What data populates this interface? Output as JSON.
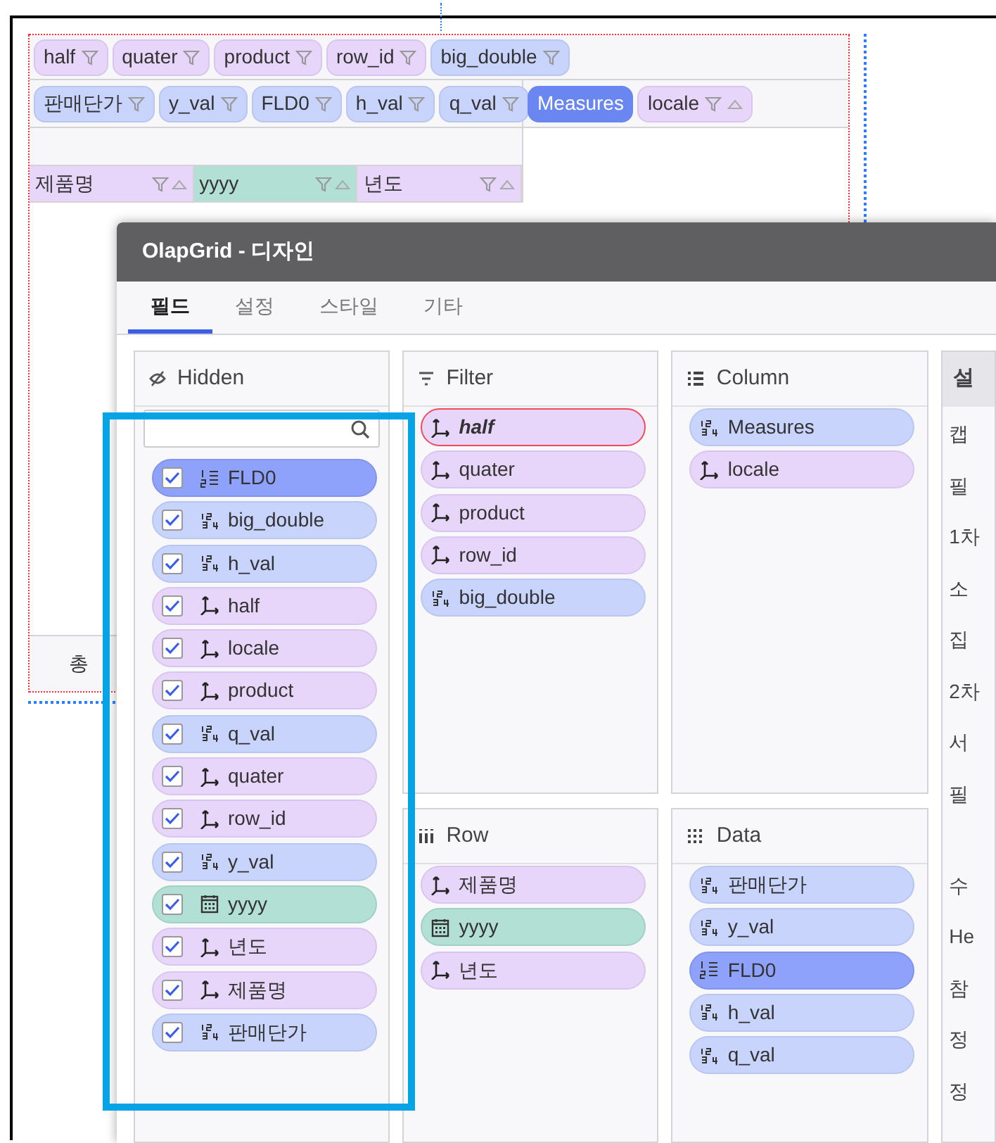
{
  "grid": {
    "filter_chips": [
      {
        "label": "half",
        "kind": "dimension"
      },
      {
        "label": "quater",
        "kind": "dimension"
      },
      {
        "label": "product",
        "kind": "dimension"
      },
      {
        "label": "row_id",
        "kind": "dimension"
      },
      {
        "label": "big_double",
        "kind": "measure"
      }
    ],
    "data_chips": [
      {
        "label": "판매단가",
        "kind": "measure"
      },
      {
        "label": "y_val",
        "kind": "measure"
      },
      {
        "label": "FLD0",
        "kind": "measure"
      },
      {
        "label": "h_val",
        "kind": "measure"
      },
      {
        "label": "q_val",
        "kind": "measure"
      }
    ],
    "column_chips": [
      {
        "label": "Measures",
        "kind": "measures"
      },
      {
        "label": "locale",
        "kind": "dimension"
      }
    ],
    "row_headers": [
      {
        "label": "제품명",
        "kind": "dimension"
      },
      {
        "label": "yyyy",
        "kind": "date"
      },
      {
        "label": "년도",
        "kind": "dimension"
      }
    ],
    "footer": "총"
  },
  "dialog": {
    "title": "OlapGrid - 디자인",
    "tabs": [
      {
        "label": "필드",
        "selected": true
      },
      {
        "label": "설정",
        "selected": false
      },
      {
        "label": "스타일",
        "selected": false
      },
      {
        "label": "기타",
        "selected": false
      }
    ],
    "hidden": {
      "title": "Hidden",
      "items": [
        {
          "label": "FLD0",
          "kind": "calc",
          "checked": true
        },
        {
          "label": "big_double",
          "kind": "measure",
          "checked": true
        },
        {
          "label": "h_val",
          "kind": "measure",
          "checked": true
        },
        {
          "label": "half",
          "kind": "dimension",
          "checked": true
        },
        {
          "label": "locale",
          "kind": "dimension",
          "checked": true
        },
        {
          "label": "product",
          "kind": "dimension",
          "checked": true
        },
        {
          "label": "q_val",
          "kind": "measure",
          "checked": true
        },
        {
          "label": "quater",
          "kind": "dimension",
          "checked": true
        },
        {
          "label": "row_id",
          "kind": "dimension",
          "checked": true
        },
        {
          "label": "y_val",
          "kind": "measure",
          "checked": true
        },
        {
          "label": "yyyy",
          "kind": "date",
          "checked": true
        },
        {
          "label": "년도",
          "kind": "dimension",
          "checked": true
        },
        {
          "label": "제품명",
          "kind": "dimension",
          "checked": true
        },
        {
          "label": "판매단가",
          "kind": "measure",
          "checked": true
        }
      ]
    },
    "filter": {
      "title": "Filter",
      "items": [
        {
          "label": "half",
          "kind": "dimension",
          "selected": true
        },
        {
          "label": "quater",
          "kind": "dimension",
          "selected": false
        },
        {
          "label": "product",
          "kind": "dimension",
          "selected": false
        },
        {
          "label": "row_id",
          "kind": "dimension",
          "selected": false
        },
        {
          "label": "big_double",
          "kind": "measure",
          "selected": false
        }
      ]
    },
    "column": {
      "title": "Column",
      "items": [
        {
          "label": "Measures",
          "kind": "measure"
        },
        {
          "label": "locale",
          "kind": "dimension"
        }
      ]
    },
    "row": {
      "title": "Row",
      "items": [
        {
          "label": "제품명",
          "kind": "dimension"
        },
        {
          "label": "yyyy",
          "kind": "date"
        },
        {
          "label": "년도",
          "kind": "dimension"
        }
      ]
    },
    "data": {
      "title": "Data",
      "items": [
        {
          "label": "판매단가",
          "kind": "measure"
        },
        {
          "label": "y_val",
          "kind": "measure"
        },
        {
          "label": "FLD0",
          "kind": "calc"
        },
        {
          "label": "h_val",
          "kind": "measure"
        },
        {
          "label": "q_val",
          "kind": "measure"
        }
      ]
    },
    "settings": {
      "title": "설",
      "items": [
        {
          "label": "캡",
          "kind": "line"
        },
        {
          "label": "필",
          "kind": "line"
        },
        {
          "label": "1차",
          "kind": "line"
        },
        {
          "label": "소",
          "kind": "line"
        },
        {
          "label": "집",
          "kind": "line"
        },
        {
          "label": "2차",
          "kind": "line"
        },
        {
          "label": "서",
          "kind": "line"
        },
        {
          "label": "필",
          "kind": "multiline"
        },
        {
          "label": "수",
          "kind": "line"
        },
        {
          "label": "He",
          "kind": "line"
        },
        {
          "label": "참",
          "kind": "line"
        },
        {
          "label": "정",
          "kind": "line"
        },
        {
          "label": "정",
          "kind": "line"
        }
      ]
    }
  }
}
